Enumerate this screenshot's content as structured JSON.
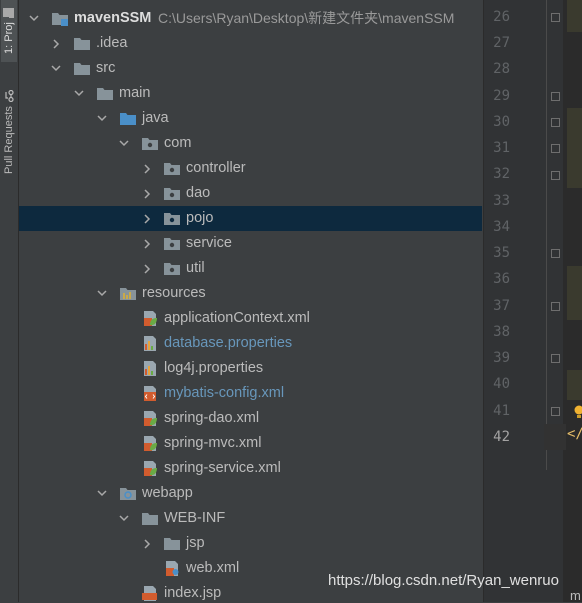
{
  "sidebar": {
    "project_tab": "1: Proj",
    "pull_requests_tab": "Pull Requests"
  },
  "tree": {
    "root": {
      "name": "mavenSSM",
      "path": "C:\\Users\\Ryan\\Desktop\\新建文件夹\\mavenSSM"
    },
    "items": [
      {
        "label": ".idea"
      },
      {
        "label": "src"
      },
      {
        "label": "main"
      },
      {
        "label": "java"
      },
      {
        "label": "com"
      },
      {
        "label": "controller"
      },
      {
        "label": "dao"
      },
      {
        "label": "pojo"
      },
      {
        "label": "service"
      },
      {
        "label": "util"
      },
      {
        "label": "resources"
      },
      {
        "label": "applicationContext.xml"
      },
      {
        "label": "database.properties"
      },
      {
        "label": "log4j.properties"
      },
      {
        "label": "mybatis-config.xml"
      },
      {
        "label": "spring-dao.xml"
      },
      {
        "label": "spring-mvc.xml"
      },
      {
        "label": "spring-service.xml"
      },
      {
        "label": "webapp"
      },
      {
        "label": "WEB-INF"
      },
      {
        "label": "jsp"
      },
      {
        "label": "web.xml"
      },
      {
        "label": "index.jsp"
      }
    ]
  },
  "editor": {
    "line_numbers": [
      "26",
      "27",
      "28",
      "29",
      "30",
      "31",
      "32",
      "33",
      "34",
      "35",
      "36",
      "37",
      "38",
      "39",
      "40",
      "41",
      "42"
    ],
    "current_line": "42",
    "code_fragment": "</",
    "bottom_char": "m"
  },
  "watermark": "https://blog.csdn.net/Ryan_wenruo",
  "colors": {
    "panel_bg": "#3c3f41",
    "selection": "#0d293e",
    "modified_file": "#6897bb",
    "folder": "#87939a",
    "source_folder": "#4a8fc8"
  }
}
